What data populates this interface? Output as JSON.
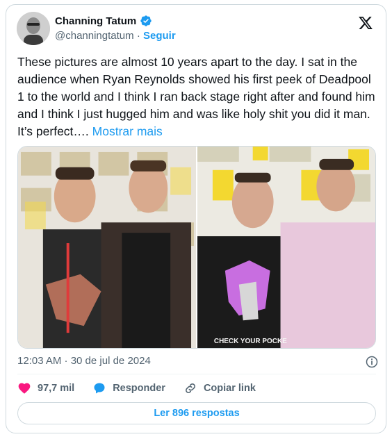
{
  "colors": {
    "accent": "#1d9bf0",
    "heart": "#f91880",
    "muted": "#536471",
    "text": "#0f1419"
  },
  "author": {
    "name": "Channing Tatum",
    "handle": "@channingtatum",
    "separator": "·",
    "follow_label": "Seguir",
    "verified_icon": "verified-badge-icon"
  },
  "logo_icon": "x-logo-icon",
  "tweet": {
    "text": "These pictures are almost 10 years apart to the day. I sat in the audience when Ryan Reynolds showed his first peek of Deadpool 1 to the world and I think I ran back stage right after and found him and I think I just hugged him and was like holy shit you did it man. It’s perfect….",
    "more_label": "Mostrar mais"
  },
  "media": {
    "photos": [
      {
        "name": "older-photo"
      },
      {
        "name": "newer-photo",
        "shirt_text": "CHECK YOUR POCKE"
      }
    ]
  },
  "timestamp": "12:03 AM · 30 de jul de 2024",
  "actions": {
    "likes": {
      "icon": "heart-icon",
      "count": "97,7 mil"
    },
    "reply": {
      "icon": "reply-bubble-icon",
      "label": "Responder"
    },
    "copy": {
      "icon": "link-icon",
      "label": "Copiar link"
    }
  },
  "replies_button": "Ler 896 respostas"
}
